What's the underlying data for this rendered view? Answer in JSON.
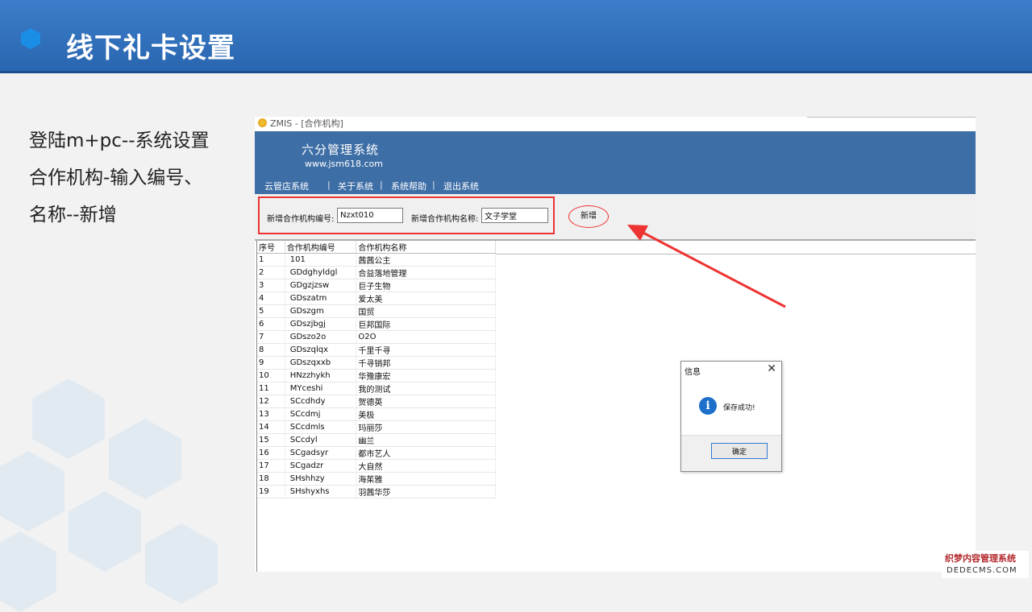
{
  "slide": {
    "title": "线下礼卡设置",
    "description": [
      "登陆m+pc--系统设置",
      "合作机构-输入编号、",
      "名称--新增"
    ]
  },
  "window": {
    "title": "ZMIS - [合作机构]",
    "app_name": "六分管理系统",
    "app_url": "www.jsm618.com",
    "menu": [
      "云管店系统",
      "关于系统",
      "系统帮助",
      "退出系统"
    ],
    "menu_separator": "|"
  },
  "form": {
    "code_label": "新增合作机构编号:",
    "code_value": "Nzxt010",
    "name_label": "新增合作机构名称:",
    "name_value": "文子学堂",
    "add_button": "新增"
  },
  "table": {
    "columns": [
      "序号",
      "合作机构编号",
      "合作机构名称"
    ],
    "rows": [
      [
        "1",
        "101",
        "茜茜公主"
      ],
      [
        "2",
        "GDdghyldgl",
        "合益落地管理"
      ],
      [
        "3",
        "GDgzjzsw",
        "巨子生物"
      ],
      [
        "4",
        "GDszatm",
        "爱太美"
      ],
      [
        "5",
        "GDszgm",
        "国贸"
      ],
      [
        "6",
        "GDszjbgj",
        "巨邦国际"
      ],
      [
        "7",
        "GDszo2o",
        "O2O"
      ],
      [
        "8",
        "GDszqlqx",
        "千里千寻"
      ],
      [
        "9",
        "GDszqxxb",
        "千寻销邦"
      ],
      [
        "10",
        "HNzzhykh",
        "华豫康宏"
      ],
      [
        "11",
        "MYceshi",
        "我的测试"
      ],
      [
        "12",
        "SCcdhdy",
        "贺德英"
      ],
      [
        "13",
        "SCcdmj",
        "美极"
      ],
      [
        "14",
        "SCcdmls",
        "玛丽莎"
      ],
      [
        "15",
        "SCcdyl",
        "幽兰"
      ],
      [
        "16",
        "SCgadsyr",
        "都市艺人"
      ],
      [
        "17",
        "SCgadzr",
        "大自然"
      ],
      [
        "18",
        "SHshhzy",
        "海茱雅"
      ],
      [
        "19",
        "SHshyxhs",
        "羽茜华莎"
      ]
    ]
  },
  "dialog": {
    "title": "信息",
    "close": "✕",
    "icon": "i",
    "message": "保存成功!",
    "ok_button": "确定"
  },
  "watermark": {
    "top": "织梦内容管理系统",
    "bottom": "DEDECMS.COM"
  },
  "colors": {
    "slide_header": "#2f6fb8",
    "app_banner": "#3e6ea6",
    "highlight": "#e33333",
    "dialog_button_border": "#2f7ad1"
  }
}
